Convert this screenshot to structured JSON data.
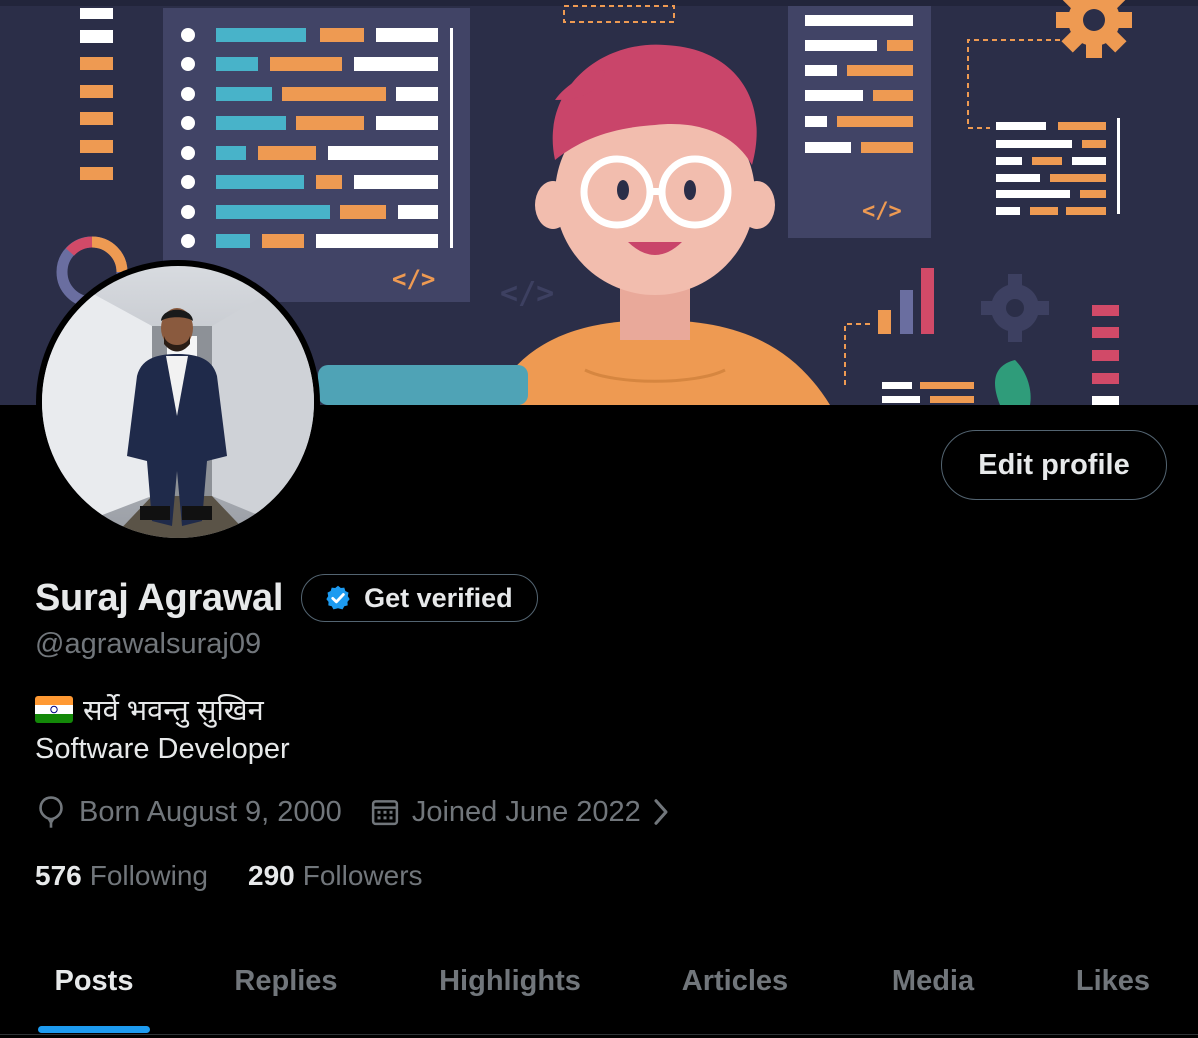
{
  "profile": {
    "name": "Suraj Agrawal",
    "get_verified_label": "Get verified",
    "handle": "@agrawalsuraj09",
    "bio_line1": "सर्वे भवन्तु सुखिन",
    "bio_line2": "Software Developer",
    "born": "Born August 9, 2000",
    "joined": "Joined June 2022",
    "following_count": "576",
    "following_label": "Following",
    "followers_count": "290",
    "followers_label": "Followers"
  },
  "actions": {
    "edit_profile_label": "Edit profile"
  },
  "banner": {
    "code_tag_1": "</>",
    "code_tag_2": "</>",
    "code_tag_3": "</>"
  },
  "tabs": [
    {
      "label": "Posts",
      "active": true
    },
    {
      "label": "Replies",
      "active": false
    },
    {
      "label": "Highlights",
      "active": false
    },
    {
      "label": "Articles",
      "active": false
    },
    {
      "label": "Media",
      "active": false
    },
    {
      "label": "Likes",
      "active": false
    }
  ],
  "colors": {
    "accent": "#1d9bf0",
    "banner_bg": "#2b2e48",
    "muted_text": "#71767b",
    "primary_text": "#e7e9ea",
    "verified_badge": "#1d9bf0"
  },
  "icons": {
    "verified": "verified-badge-icon",
    "born": "balloon-icon",
    "joined": "calendar-icon",
    "chevron": "chevron-right-icon"
  }
}
